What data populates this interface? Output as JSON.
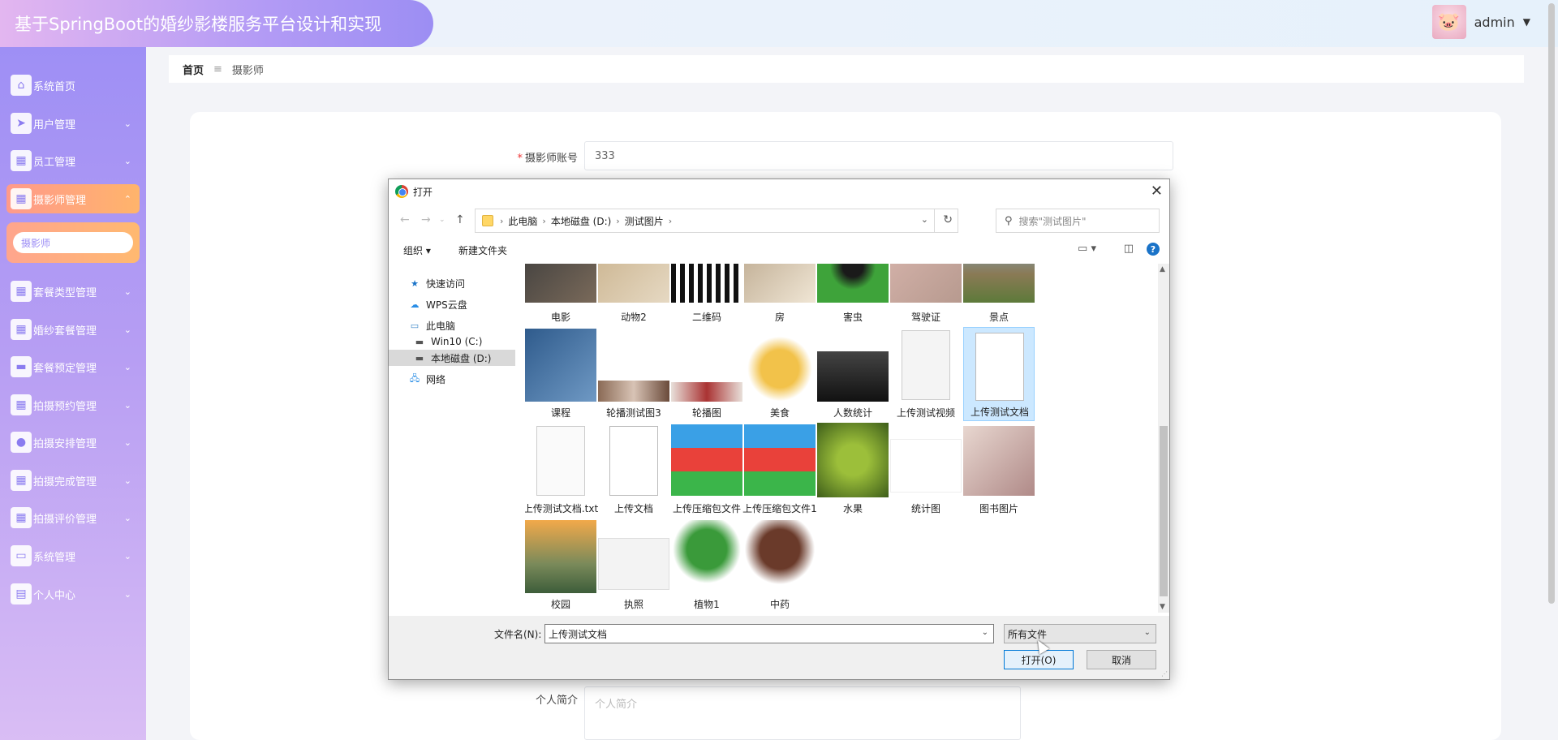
{
  "header": {
    "title": "基于SpringBoot的婚纱影楼服务平台设计和实现",
    "user": "admin"
  },
  "sidebar": {
    "items": [
      {
        "label": "系统首页",
        "icon": "home-icon"
      },
      {
        "label": "用户管理",
        "icon": "send-icon"
      },
      {
        "label": "员工管理",
        "icon": "grid-icon"
      },
      {
        "label": "摄影师管理",
        "icon": "grid-icon",
        "active": true
      },
      {
        "label": "套餐类型管理",
        "icon": "grid-icon"
      },
      {
        "label": "婚纱套餐管理",
        "icon": "grid-icon"
      },
      {
        "label": "套餐预定管理",
        "icon": "ticket-icon"
      },
      {
        "label": "拍摄预约管理",
        "icon": "grid-icon"
      },
      {
        "label": "拍摄安排管理",
        "icon": "person-icon"
      },
      {
        "label": "拍摄完成管理",
        "icon": "grid-icon"
      },
      {
        "label": "拍摄评价管理",
        "icon": "grid-icon"
      },
      {
        "label": "系统管理",
        "icon": "monitor-icon"
      },
      {
        "label": "个人中心",
        "icon": "card-icon"
      }
    ],
    "sub_item": "摄影师"
  },
  "breadcrumb": {
    "home": "首页",
    "separator": "≡",
    "current": "摄影师"
  },
  "form": {
    "account_label": "摄影师账号",
    "account_value": "333",
    "intro_label": "个人简介",
    "intro_placeholder": "个人简介"
  },
  "dialog": {
    "title": "打开",
    "path": [
      "此电脑",
      "本地磁盘 (D:)",
      "测试图片"
    ],
    "search_placeholder": "搜索\"测试图片\"",
    "toolbar": {
      "organize": "组织",
      "new_folder": "新建文件夹"
    },
    "tree": [
      {
        "label": "快速访问",
        "icon": "star-icon"
      },
      {
        "label": "WPS云盘",
        "icon": "cloud-icon"
      },
      {
        "label": "此电脑",
        "icon": "computer-icon"
      },
      {
        "label": "Win10 (C:)",
        "icon": "drive-icon"
      },
      {
        "label": "本地磁盘 (D:)",
        "icon": "drive-icon",
        "selected": true
      },
      {
        "label": "网络",
        "icon": "network-icon"
      }
    ],
    "files": [
      "电影",
      "动物2",
      "二维码",
      "房",
      "害虫",
      "驾驶证",
      "景点",
      "课程",
      "轮播测试图3",
      "轮播图",
      "美食",
      "人数统计",
      "上传测试视频",
      "上传测试文档",
      "上传测试文档.txt",
      "上传文档",
      "上传压缩包文件",
      "上传压缩包文件1",
      "水果",
      "统计图",
      "图书图片",
      "校园",
      "执照",
      "植物1",
      "中药"
    ],
    "selected_file": "上传测试文档",
    "filename_label": "文件名(N):",
    "filename_value": "上传测试文档",
    "filetype": "所有文件",
    "open_button": "打开(O)",
    "cancel_button": "取消"
  }
}
